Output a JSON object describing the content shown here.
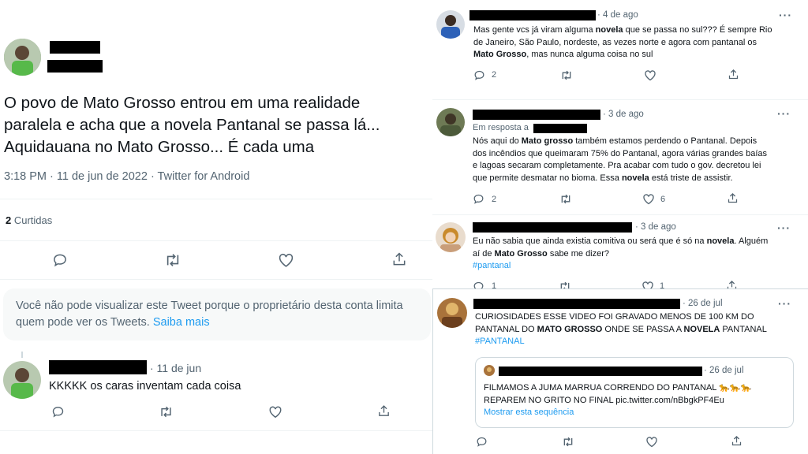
{
  "main_tweet": {
    "text": "O povo de Mato Grosso entrou em uma realidade paralela e acha que a novela Pantanal se passa lá... Aquidauana no Mato Grosso... É cada uma",
    "line1": "O povo de Mato Grosso entrou em uma realidade",
    "line2": "paralela e acha que a novela Pantanal se passa lá...",
    "line3": "Aquidauana no Mato Grosso... É cada uma",
    "time": "3:18 PM · 11 de jun de 2022 · ",
    "client": "Twitter for Android",
    "likes_count": "2",
    "likes_label": "Curtidas"
  },
  "limited_notice": {
    "line1": "Você não pode visualizar este Tweet porque o proprietário desta conta limita",
    "line2_prefix": "quem pode ver os Tweets. ",
    "learn_more": "Saiba mais"
  },
  "reply_left": {
    "date": "· 11 de jun",
    "text": "KKKKK os caras inventam cada coisa"
  },
  "right_tweets": [
    {
      "date": "· 4 de ago",
      "l1_a": "Mas gente vcs já viram alguma ",
      "l1_b": "novela",
      "l1_c": " que se passa no sul??? É sempre Rio",
      "l2": "de Janeiro, São Paulo, nordeste, as vezes norte e agora com pantanal os",
      "l3_a": "Mato Grosso",
      "l3_b": ", mas nunca alguma coisa no sul",
      "reply_count": "2"
    },
    {
      "date": "· 3 de ago",
      "reply_to": "Em resposta a",
      "l1_a": "Nós aqui do ",
      "l1_b": "Mato grosso",
      "l1_c": " também estamos perdendo o Pantanal. Depois",
      "l2": "dos incêndios que queimaram 75% do Pantanal, agora várias grandes baías",
      "l3": "e lagoas secaram completamente. Pra acabar com tudo o gov.  decretou  lei",
      "l4_a": "que permite desmatar no bioma. Essa ",
      "l4_b": "novela",
      "l4_c": " está triste de assistir.",
      "reply_count": "2",
      "like_count": "6"
    },
    {
      "date": "· 3 de ago",
      "l1_a": "Eu não sabia que ainda existia comitiva ou será que é só na ",
      "l1_b": "novela",
      "l1_c": ". Alguém",
      "l2_a": "aí de ",
      "l2_b": "Mato Grosso",
      "l2_c": " sabe me dizer?",
      "hashtag": "#pantanal",
      "reply_count": "1",
      "like_count": "1"
    },
    {
      "date": "· 26 de jul",
      "l1": "CURIOSIDADES ESSE VIDEO FOI GRAVADO MENOS DE 100 KM DO",
      "l2_a": "PANTANAL DO ",
      "l2_b": "MATO GROSSO",
      "l2_c": " ONDE SE PASSA A ",
      "l2_d": "NOVELA",
      "l2_e": " PANTANAL",
      "hashtag": "#PANTANAL",
      "quote": {
        "date": "· 26 de jul",
        "l1": "FILMAMOS A JUMA MARRUA CORRENDO DO PANTANAL 🐆🐆🐆",
        "l2": "REPAREM NO GRITO NO FINAL pic.twitter.com/nBbgkPF4Eu",
        "show_thread": "Mostrar esta sequência"
      }
    }
  ]
}
